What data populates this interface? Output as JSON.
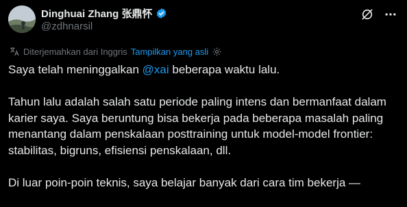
{
  "author": {
    "display_name": "Dinghuai Zhang 张鼎怀",
    "handle": "@zdhnarsil",
    "verified": true
  },
  "header_actions": {
    "grok_icon": "grok-icon",
    "more_icon": "more-icon"
  },
  "translation": {
    "label": "Diterjemahkan dari Inggris",
    "show_original": "Tampilkan yang asli",
    "settings_icon": "gear-icon"
  },
  "tweet": {
    "line1_before": "Saya telah meninggalkan ",
    "mention": "@xai",
    "line1_after": " beberapa waktu lalu.",
    "paragraph2": "Tahun lalu adalah salah satu periode paling intens dan bermanfaat dalam karier saya. Saya beruntung bisa bekerja pada beberapa masalah paling menantang dalam penskalaan posttraining untuk model-model frontier: stabilitas, bigruns, efisiensi penskalaan, dll.",
    "paragraph3": "Di luar poin-poin teknis, saya belajar banyak dari cara tim bekerja —"
  },
  "colors": {
    "background": "#000000",
    "text": "#e7e9ea",
    "secondary": "#71767b",
    "accent": "#1d9bf0"
  }
}
